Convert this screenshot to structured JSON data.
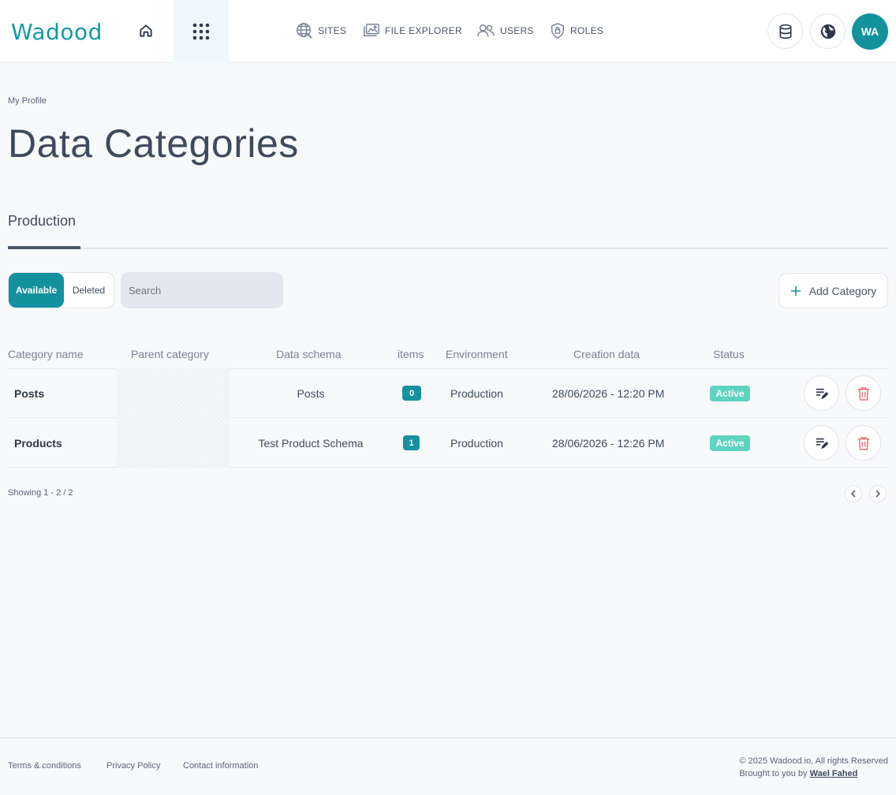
{
  "header": {
    "logo": "Wadood",
    "nav": [
      {
        "label": "SITES",
        "icon": "globe-icon"
      },
      {
        "label": "FILE EXPLORER",
        "icon": "folder-image-icon"
      },
      {
        "label": "USERS",
        "icon": "users-icon"
      },
      {
        "label": "ROLES",
        "icon": "shield-icon"
      }
    ],
    "avatar_initials": "WA"
  },
  "page": {
    "breadcrumb": "My Profile",
    "title": "Data Categories",
    "tab": "Production"
  },
  "toolbar": {
    "filter_available": "Available",
    "filter_deleted": "Deleted",
    "search_placeholder": "Search",
    "add_label": "Add Category"
  },
  "table": {
    "columns": [
      "Category name",
      "Parent category",
      "Data schema",
      "items",
      "Environment",
      "Creation data",
      "Status"
    ],
    "rows": [
      {
        "name": "Posts",
        "parent": "",
        "schema": "Posts",
        "items": "0",
        "environment": "Production",
        "created": "28/06/2026 - 12:20 PM",
        "status": "Active"
      },
      {
        "name": "Products",
        "parent": "",
        "schema": "Test Product Schema",
        "items": "1",
        "environment": "Production",
        "created": "28/06/2026 - 12:26 PM",
        "status": "Active"
      }
    ]
  },
  "pagination": {
    "summary": "Showing 1 - 2 / 2"
  },
  "footer": {
    "links": [
      "Terms & conditions",
      "Privacy Policy",
      "Contact information"
    ],
    "copyright": "© 2025 Wadood.io, All rights Reserved",
    "brought_by": "Brought to you by",
    "author": "Wael Fahed"
  },
  "colors": {
    "accent": "#13929e",
    "status_active": "#5fd3c1",
    "delete": "#e8737b"
  }
}
